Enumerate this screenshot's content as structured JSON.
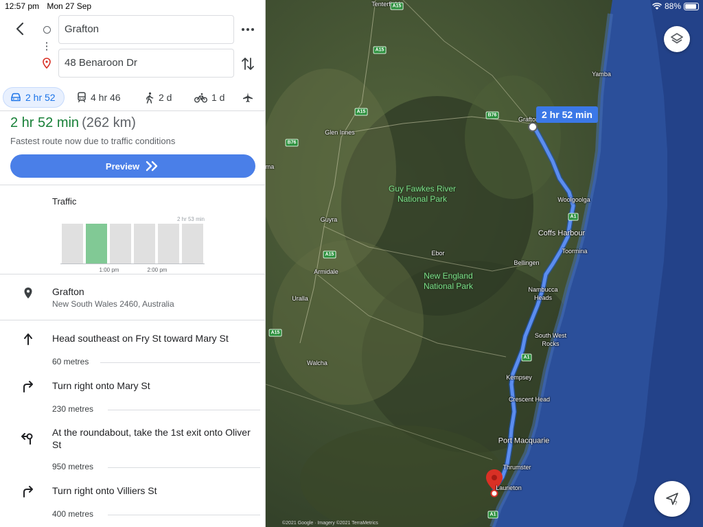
{
  "status": {
    "time": "12:57 pm",
    "date": "Mon 27 Sep",
    "battery": "88%"
  },
  "origin": "Grafton",
  "destination": "48 Benaroon Dr",
  "modes": [
    {
      "icon": "car-icon",
      "label": "2 hr 52",
      "active": true
    },
    {
      "icon": "train-icon",
      "label": "4 hr 46"
    },
    {
      "icon": "walking-icon",
      "label": "2 d"
    },
    {
      "icon": "cycling-icon",
      "label": "1 d"
    },
    {
      "icon": "flight-icon",
      "label": ""
    }
  ],
  "summary": {
    "time": "2 hr 52 min",
    "distance": "(262 km)",
    "note": "Fastest route now due to traffic conditions",
    "preview_label": "Preview"
  },
  "traffic": {
    "title": "Traffic",
    "top_label": "2 hr 53 min",
    "ticks": [
      "1:00 pm",
      "2:00 pm"
    ],
    "selected_bar": 1
  },
  "start_place": {
    "title": "Grafton",
    "subtitle": "New South Wales 2460, Australia"
  },
  "steps": [
    {
      "icon": "straight-arrow-icon",
      "text": "Head southeast on Fry St toward Mary St",
      "distance": "60 metres"
    },
    {
      "icon": "turn-right-icon",
      "text": "Turn right onto Mary St",
      "distance": "230 metres"
    },
    {
      "icon": "roundabout-icon",
      "text": "At the roundabout, take the 1st exit onto Oliver St",
      "distance": "950 metres"
    },
    {
      "icon": "turn-right-icon",
      "text": "Turn right onto Villiers St",
      "distance": "400 metres"
    }
  ],
  "map": {
    "route_label": "2 hr 52 min",
    "copyright": "©2021 Google · Imagery ©2021 TerraMetrics",
    "places": {
      "tenterfield": "Tenterfield",
      "yamba": "Yamba",
      "grafton": "Grafton",
      "glen_innes": "Glen Innes",
      "guy_fawkes": "Guy Fawkes River National Park",
      "woolgoolga": "Woolgoolga",
      "guyra": "Guyra",
      "coffs_harbour": "Coffs Harbour",
      "ebor": "Ebor",
      "toormina": "Toormina",
      "bellingen": "Bellingen",
      "armidale": "Armidale",
      "new_england": "New England National Park",
      "nambucca": "Nambucca Heads",
      "uralla": "Uralla",
      "south_west_rocks": "South West Rocks",
      "walcha": "Walcha",
      "kempsey": "Kempsey",
      "crescent_head": "Crescent Head",
      "port_macquarie": "Port Macquarie",
      "thrumster": "Thrumster",
      "laurieton": "Laurieton"
    },
    "roads": {
      "a1": "A1",
      "a15": "A15",
      "b76": "B76",
      "ma": "ma"
    },
    "colors": {
      "land": "#3d4a2f",
      "ocean": "#2b4f9a",
      "route": "#5b8df0",
      "dest_pin": "#d93025"
    }
  }
}
